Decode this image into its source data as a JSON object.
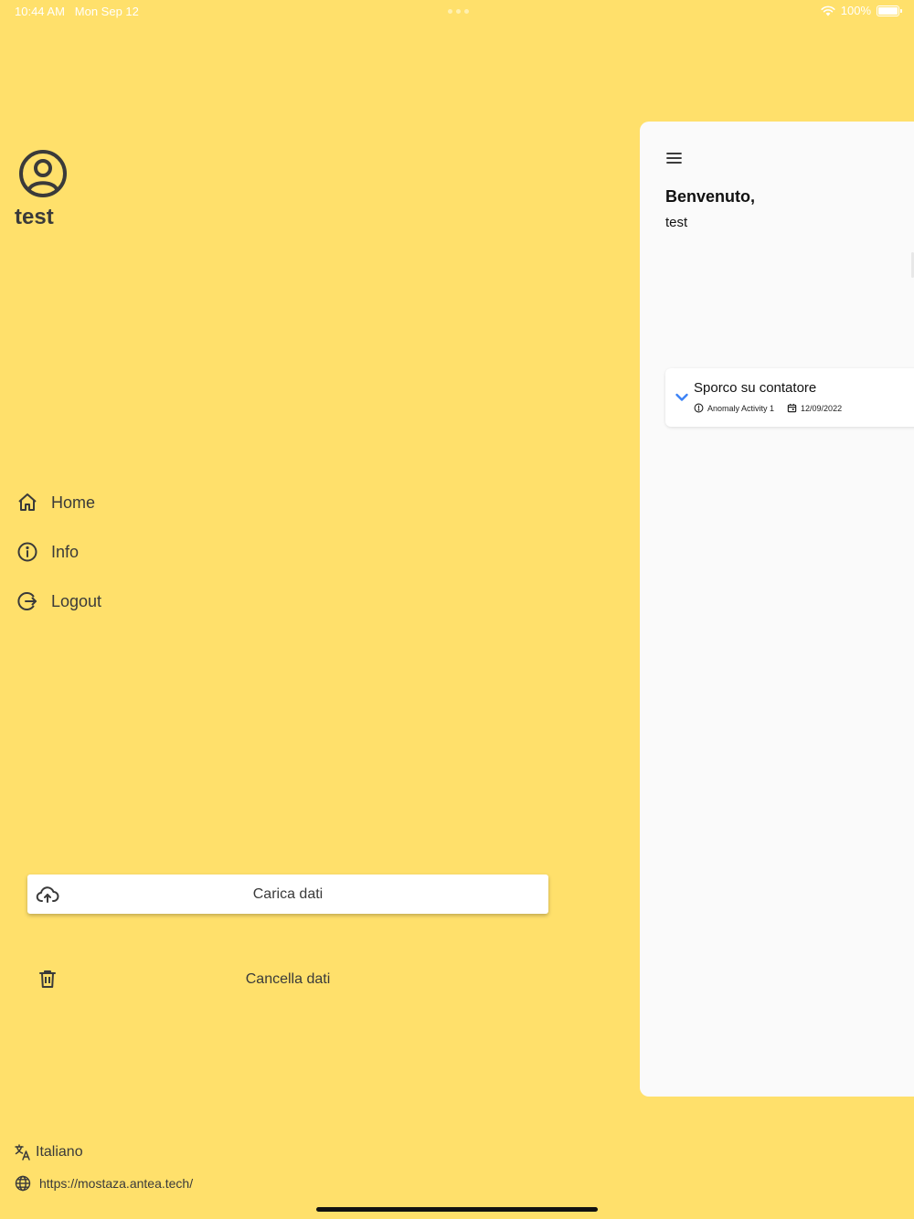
{
  "status_bar": {
    "time": "10:44 AM",
    "date": "Mon Sep 12",
    "battery": "100%"
  },
  "profile": {
    "username": "test"
  },
  "nav": {
    "home": "Home",
    "info": "Info",
    "logout": "Logout"
  },
  "actions": {
    "upload_label": "Carica dati",
    "delete_label": "Cancella dati"
  },
  "footer": {
    "language": "Italiano",
    "website": "https://mostaza.antea.tech/"
  },
  "panel": {
    "welcome_title": "Benvenuto,",
    "welcome_user": "test",
    "card": {
      "title": "Sporco su contatore",
      "activity": "Anomaly Activity 1",
      "date": "12/09/2022"
    }
  },
  "colors": {
    "background": "#FFE06B",
    "panel": "#FAFAFA",
    "accent": "#3B82F6",
    "text": "#3A3A3A"
  },
  "icons": [
    "wifi-icon",
    "battery-icon",
    "user-circle-icon",
    "home-icon",
    "info-icon",
    "logout-icon",
    "cloud-upload-icon",
    "trash-icon",
    "translate-icon",
    "globe-icon",
    "menu-icon",
    "chevron-down-icon",
    "alert-circle-icon",
    "calendar-icon"
  ]
}
